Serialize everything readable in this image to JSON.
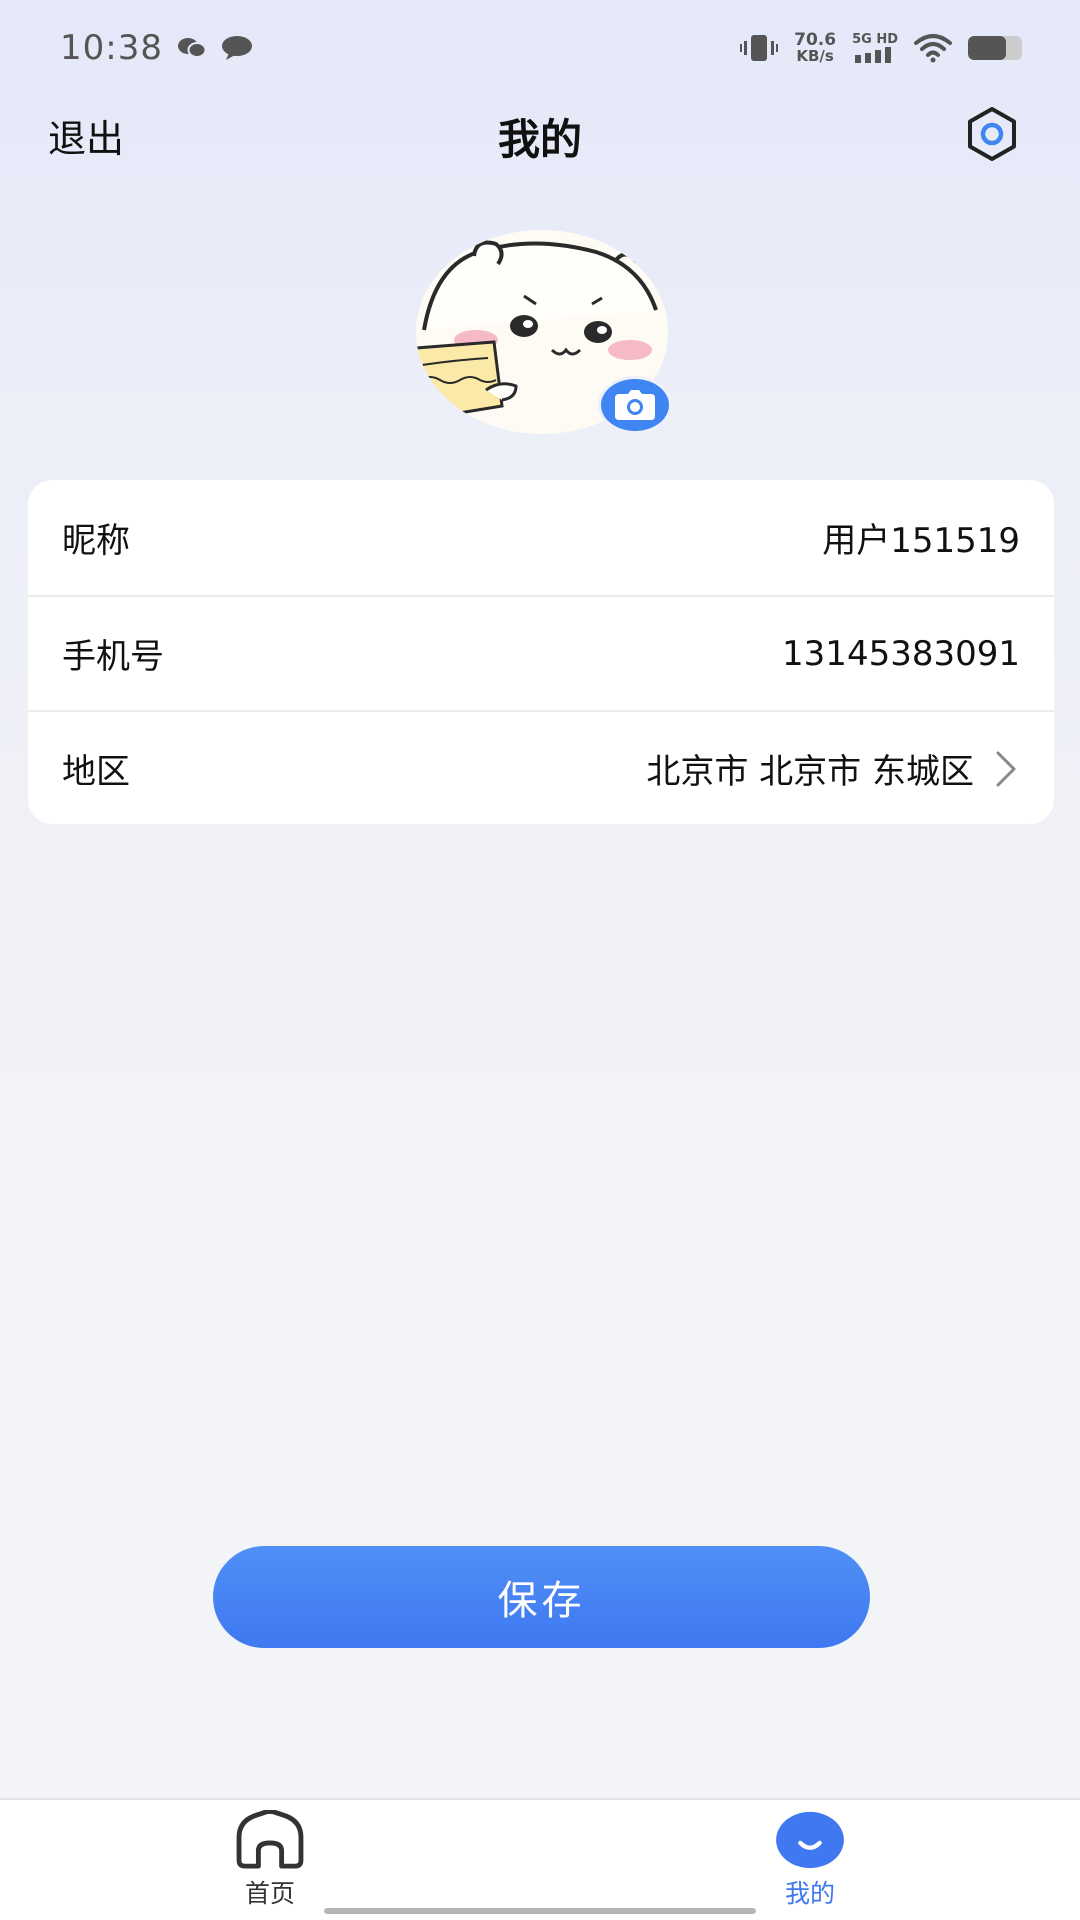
{
  "status_bar": {
    "time": "10:38",
    "net_speed_value": "70.6",
    "net_speed_unit": "KB/s",
    "network_type": "5G HD",
    "battery_level": 0.7
  },
  "header": {
    "exit_label": "退出",
    "title": "我的"
  },
  "profile": {
    "fields": [
      {
        "label": "昵称",
        "value": "用户151519"
      },
      {
        "label": "手机号",
        "value": "13145383091"
      },
      {
        "label": "地区",
        "value": "北京市 北京市 东城区"
      }
    ]
  },
  "save_label": "保存",
  "tabs": [
    {
      "label": "首页",
      "icon": "home-icon"
    },
    {
      "label": "我的",
      "icon": "smile-icon",
      "active": true
    }
  ],
  "colors": {
    "accent": "#3f78f0",
    "background_top": "#e4e8f8",
    "background_bottom": "#f4f5f8"
  }
}
